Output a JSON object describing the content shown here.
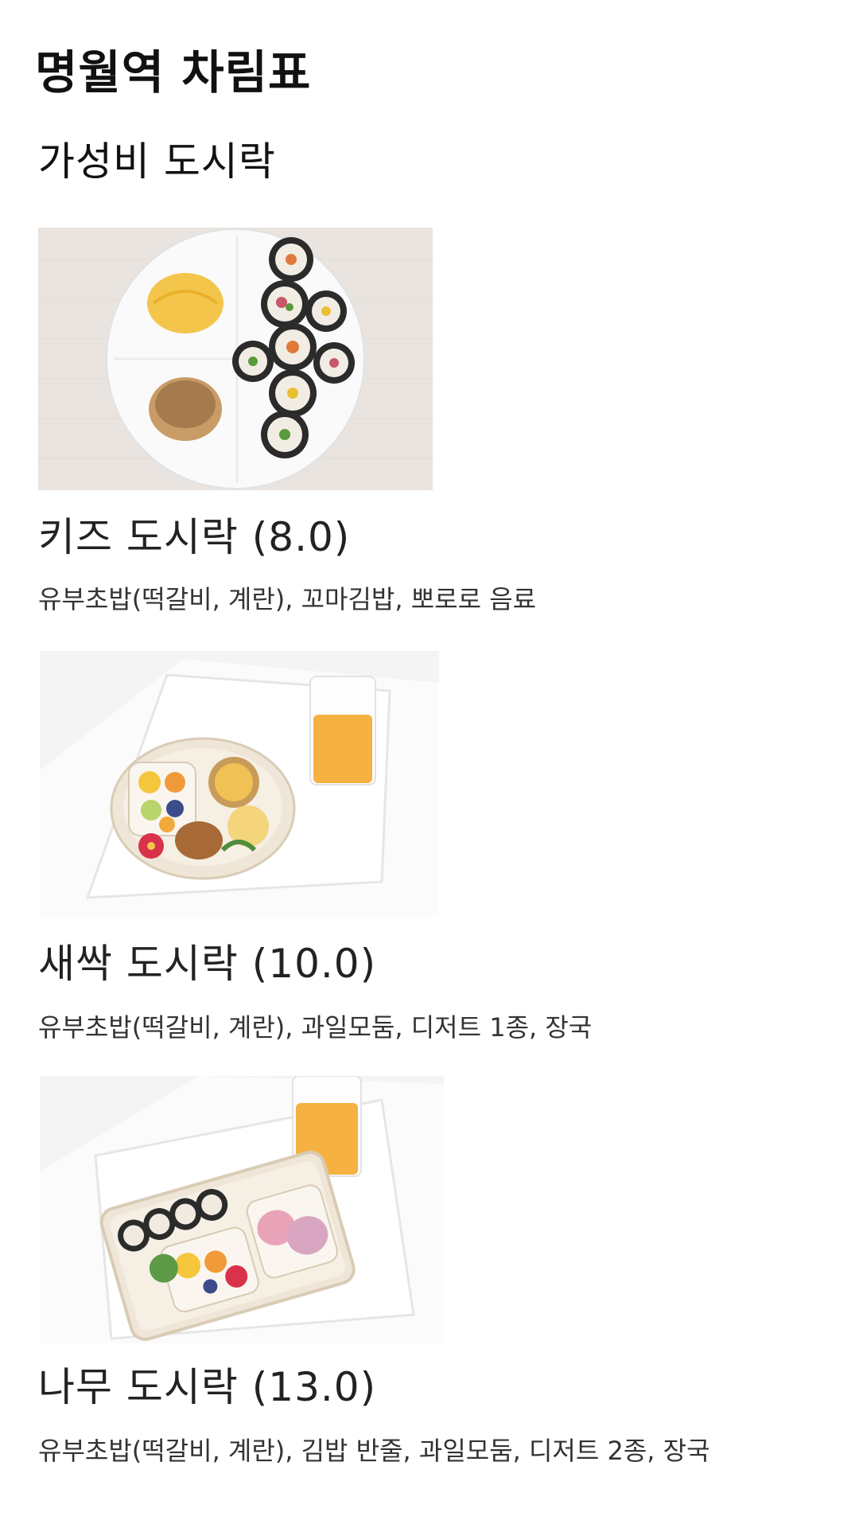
{
  "page": {
    "title": "명월역 차림표",
    "subtitle": "가성비 도시락"
  },
  "menu": [
    {
      "name": "키즈 도시락 (8.0)",
      "description": "유부초밥(떡갈비, 계란), 꼬마김밥, 뽀로로 음료"
    },
    {
      "name": "새싹 도시락 (10.0)",
      "description": "유부초밥(떡갈비, 계란), 과일모둠, 디저트 1종, 장국"
    },
    {
      "name": "나무 도시락 (13.0)",
      "description": "유부초밥(떡갈비, 계란), 김밥 반줄, 과일모둠, 디저트 2종, 장국"
    }
  ],
  "colors": {
    "background": "#ffffff",
    "text": "#111111"
  }
}
